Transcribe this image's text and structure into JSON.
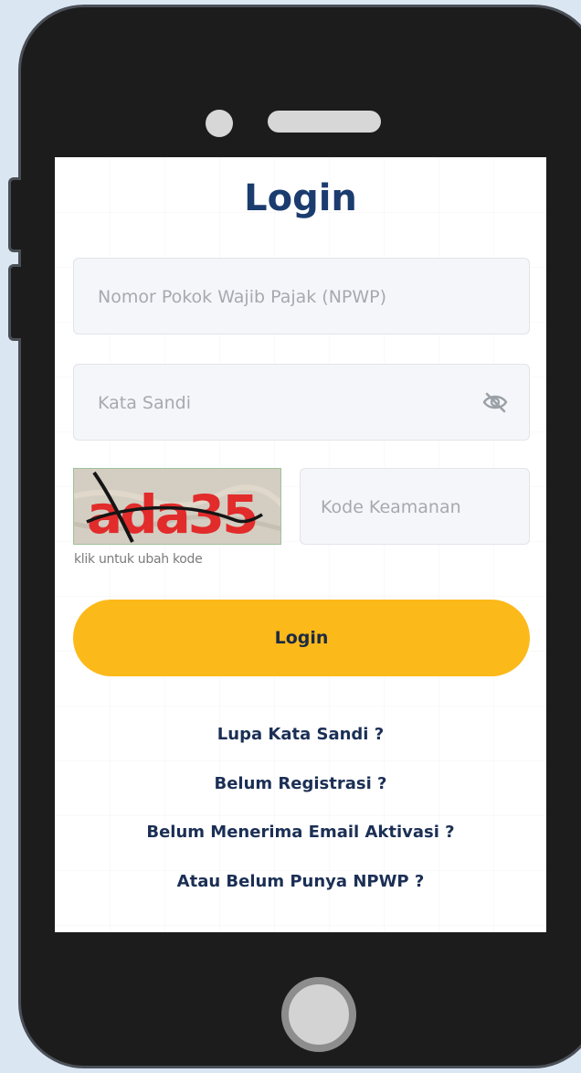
{
  "login": {
    "title": "Login",
    "npwp_placeholder": "Nomor Pokok Wajib Pajak (NPWP)",
    "password_placeholder": "Kata Sandi",
    "captcha_text": "ada35",
    "captcha_hint": "klik untuk ubah kode",
    "security_code_placeholder": "Kode Keamanan",
    "login_button": "Login",
    "links": [
      "Lupa Kata Sandi ?",
      "Belum Registrasi ?",
      "Belum Menerima Email Aktivasi ?",
      "Atau Belum Punya NPWP ?"
    ]
  },
  "icons": {
    "password_toggle": "eye-slash-icon"
  },
  "colors": {
    "accent": "#fcb91a",
    "title": "#1b3c6e",
    "link": "#1b2f55",
    "background": "#dbe6f3",
    "phone": "#1c1c1c"
  }
}
